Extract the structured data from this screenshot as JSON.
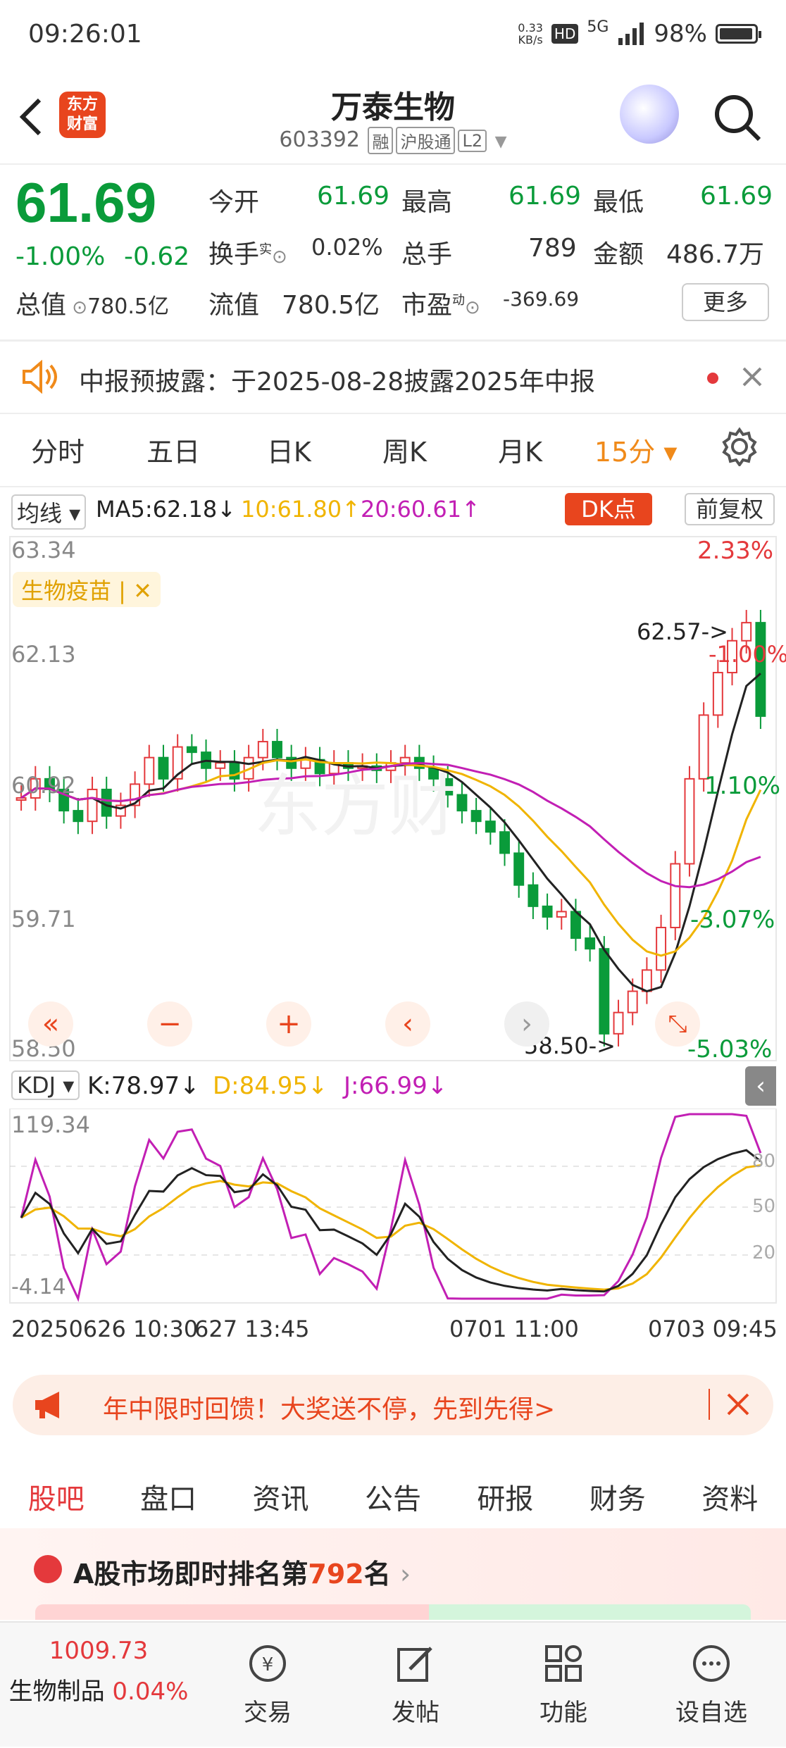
{
  "status_bar": {
    "time": "09:26:01",
    "net_speed": "0.33\nKB/s",
    "hd": "HD",
    "signal": "5G",
    "battery": "98%"
  },
  "header": {
    "logo_text": "东方\n财富",
    "stock_name": "万泰生物",
    "code": "603392",
    "tag_margin": "融",
    "tag_connect": "沪股通",
    "tag_level": "L2"
  },
  "quote": {
    "last": "61.69",
    "change_pct": "-1.00%",
    "change": "-0.62",
    "open_label": "今开",
    "open": "61.69",
    "high_label": "最高",
    "high": "61.69",
    "low_label": "最低",
    "low": "61.69",
    "turnover_label": "换手",
    "turnover_sup": "实",
    "turnover": "0.02%",
    "volume_label": "总手",
    "volume": "789",
    "amount_label": "金额",
    "amount": "486.7万",
    "mcap_label": "总值",
    "mcap": "780.5亿",
    "float_label": "流值",
    "float": "780.5亿",
    "pe_label": "市盈",
    "pe_sup": "动",
    "pe": "-369.69",
    "more": "更多"
  },
  "notice": {
    "text": "中报预披露：于2025-08-28披露2025年中报"
  },
  "period_tabs": [
    {
      "label": "分时"
    },
    {
      "label": "五日"
    },
    {
      "label": "日K"
    },
    {
      "label": "周K"
    },
    {
      "label": "月K"
    },
    {
      "label": "15分 ▾",
      "active": true
    }
  ],
  "chart_header": {
    "ma_select": "均线 ▾",
    "ma5": "MA5:62.18↓",
    "ma10": "10:61.80↑",
    "ma20": "20:60.61↑",
    "dk": "DK点",
    "fq": "前复权"
  },
  "chart_labels": {
    "concept_tag": "生物疫苗 | ✕",
    "y_ticks": [
      "63.34",
      "62.13",
      "60.92",
      "59.71",
      "58.50"
    ],
    "right_pcts": [
      "2.33%",
      "1.10%",
      "-3.07%",
      "-5.03%"
    ],
    "hi_marker": "62.57->",
    "lo_marker": "58.50->",
    "pct_mid": "-1.00%"
  },
  "kdj": {
    "select": "KDJ ▾",
    "k": "K:78.97↓",
    "d": "D:84.95↓",
    "j": "J:66.99↓",
    "y_top": "119.34",
    "y_bottom": "-4.14",
    "levels": [
      "80",
      "50",
      "20"
    ]
  },
  "x_axis": {
    "labels": [
      "20250626 10:30",
      "627 13:45",
      "0701 11:00",
      "0703 09:45"
    ]
  },
  "chart_data": {
    "type": "candlestick",
    "title": "",
    "ylim": [
      58.5,
      63.34
    ],
    "prices": [
      60.92,
      61.1,
      61.0,
      60.8,
      60.7,
      61.0,
      60.75,
      60.85,
      61.05,
      61.3,
      61.1,
      61.4,
      61.35,
      61.2,
      61.25,
      61.1,
      61.3,
      61.45,
      61.3,
      61.2,
      61.28,
      61.15,
      61.25,
      61.2,
      61.22,
      61.18,
      61.25,
      61.3,
      61.2,
      61.1,
      60.95,
      60.8,
      60.7,
      60.6,
      60.4,
      60.1,
      59.9,
      59.8,
      59.85,
      59.6,
      59.5,
      58.7,
      58.9,
      59.1,
      59.3,
      59.7,
      60.3,
      61.1,
      61.7,
      62.1,
      62.4,
      62.57,
      61.69
    ]
  },
  "promo": {
    "text": "年中限时回馈！大奖送不停，先到先得>"
  },
  "sub_tabs": [
    {
      "label": "股吧",
      "active": true
    },
    {
      "label": "盘口"
    },
    {
      "label": "资讯"
    },
    {
      "label": "公告"
    },
    {
      "label": "研报"
    },
    {
      "label": "财务"
    },
    {
      "label": "资料"
    }
  ],
  "rank": {
    "prefix": "A股市场即时排名第",
    "num": "792",
    "suffix": "名"
  },
  "bottom_nav": {
    "index_value": "1009.73",
    "index_name": "生物制品",
    "index_change": "0.04%",
    "items": [
      "交易",
      "发帖",
      "功能",
      "设自选"
    ]
  }
}
